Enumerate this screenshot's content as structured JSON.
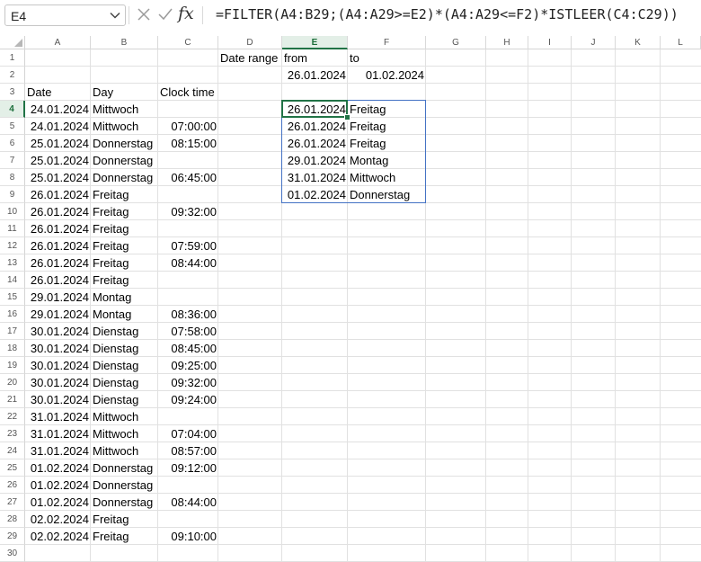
{
  "formula_bar": {
    "name_box": "E4",
    "fx_label": "fx",
    "formula": "=FILTER(A4:B29;(A4:A29>=E2)*(A4:A29<=F2)*ISTLEER(C4:C29))"
  },
  "active_cell": "E4",
  "columns": [
    "A",
    "B",
    "C",
    "D",
    "E",
    "F",
    "G",
    "H",
    "I",
    "J",
    "K",
    "L"
  ],
  "rows": [
    "1",
    "2",
    "3",
    "4",
    "5",
    "6",
    "7",
    "8",
    "9",
    "10",
    "11",
    "12",
    "13",
    "14",
    "15",
    "16",
    "17",
    "18",
    "19",
    "20",
    "21",
    "22",
    "23",
    "24",
    "25",
    "26",
    "27",
    "28",
    "29",
    "30"
  ],
  "cells": {
    "D1": "Date range",
    "E1": "from",
    "F1": "to",
    "E2": "26.01.2024",
    "F2": "01.02.2024",
    "A3": "Date",
    "B3": "Day",
    "C3": "Clock time"
  },
  "table": [
    {
      "date": "24.01.2024",
      "day": "Mittwoch",
      "time": ""
    },
    {
      "date": "24.01.2024",
      "day": "Mittwoch",
      "time": "07:00:00"
    },
    {
      "date": "25.01.2024",
      "day": "Donnerstag",
      "time": "08:15:00"
    },
    {
      "date": "25.01.2024",
      "day": "Donnerstag",
      "time": ""
    },
    {
      "date": "25.01.2024",
      "day": "Donnerstag",
      "time": "06:45:00"
    },
    {
      "date": "26.01.2024",
      "day": "Freitag",
      "time": ""
    },
    {
      "date": "26.01.2024",
      "day": "Freitag",
      "time": "09:32:00"
    },
    {
      "date": "26.01.2024",
      "day": "Freitag",
      "time": ""
    },
    {
      "date": "26.01.2024",
      "day": "Freitag",
      "time": "07:59:00"
    },
    {
      "date": "26.01.2024",
      "day": "Freitag",
      "time": "08:44:00"
    },
    {
      "date": "26.01.2024",
      "day": "Freitag",
      "time": ""
    },
    {
      "date": "29.01.2024",
      "day": "Montag",
      "time": ""
    },
    {
      "date": "29.01.2024",
      "day": "Montag",
      "time": "08:36:00"
    },
    {
      "date": "30.01.2024",
      "day": "Dienstag",
      "time": "07:58:00"
    },
    {
      "date": "30.01.2024",
      "day": "Dienstag",
      "time": "08:45:00"
    },
    {
      "date": "30.01.2024",
      "day": "Dienstag",
      "time": "09:25:00"
    },
    {
      "date": "30.01.2024",
      "day": "Dienstag",
      "time": "09:32:00"
    },
    {
      "date": "30.01.2024",
      "day": "Dienstag",
      "time": "09:24:00"
    },
    {
      "date": "31.01.2024",
      "day": "Mittwoch",
      "time": ""
    },
    {
      "date": "31.01.2024",
      "day": "Mittwoch",
      "time": "07:04:00"
    },
    {
      "date": "31.01.2024",
      "day": "Mittwoch",
      "time": "08:57:00"
    },
    {
      "date": "01.02.2024",
      "day": "Donnerstag",
      "time": "09:12:00"
    },
    {
      "date": "01.02.2024",
      "day": "Donnerstag",
      "time": ""
    },
    {
      "date": "01.02.2024",
      "day": "Donnerstag",
      "time": "08:44:00"
    },
    {
      "date": "02.02.2024",
      "day": "Freitag",
      "time": ""
    },
    {
      "date": "02.02.2024",
      "day": "Freitag",
      "time": "09:10:00"
    }
  ],
  "filter_result": [
    {
      "date": "26.01.2024",
      "day": "Freitag"
    },
    {
      "date": "26.01.2024",
      "day": "Freitag"
    },
    {
      "date": "26.01.2024",
      "day": "Freitag"
    },
    {
      "date": "29.01.2024",
      "day": "Montag"
    },
    {
      "date": "31.01.2024",
      "day": "Mittwoch"
    },
    {
      "date": "01.02.2024",
      "day": "Donnerstag"
    }
  ],
  "icons": {
    "cancel": "x-icon",
    "enter": "check-icon",
    "dropdown": "chevron-down-icon"
  },
  "colors": {
    "accent_green": "#217346",
    "spill_blue": "#4472c4"
  }
}
